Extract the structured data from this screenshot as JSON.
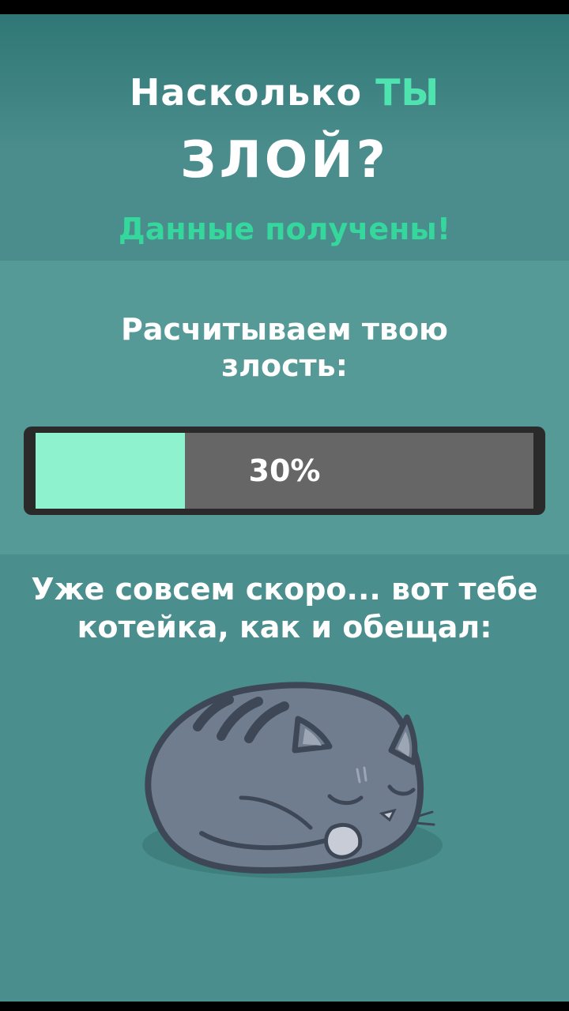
{
  "title": {
    "line1_prefix": "Насколько ",
    "line1_accent": "ТЫ",
    "line2": "ЗЛОЙ?"
  },
  "status": "Данные получены!",
  "calc_label": "Расчитываем твою злость:",
  "progress": {
    "value": 0.3,
    "text": "30%"
  },
  "note": "Уже совсем скоро... вот тебе котейка, как и обещал:",
  "icons": {
    "cat": "sleeping-cat-illustration"
  },
  "colors": {
    "accent": "#4fe3b0",
    "status": "#35d79c",
    "progress_fill": "#8ef2cf",
    "progress_track": "#676667"
  }
}
